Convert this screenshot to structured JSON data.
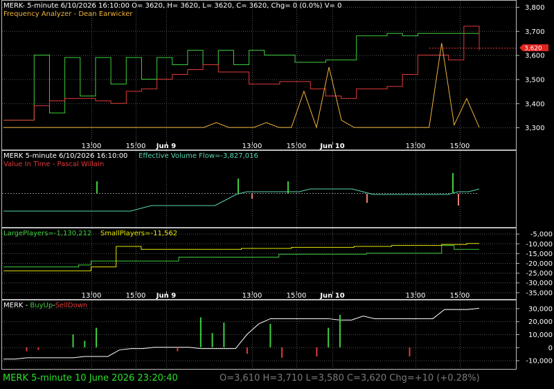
{
  "colors": {
    "green": "#3ecf3e",
    "red": "#e23a3a",
    "orange": "#f0b43a",
    "yellow": "#e8e800",
    "cyan": "#59d6b3",
    "white": "#ffffff",
    "gray": "#7a7a7a",
    "status_green": "#29e129",
    "price_badge": "#e0241e"
  },
  "panel1": {
    "header": "MERK- 5-minute 6/10/2026 16:10:00 O= 3620, H= 3620, L= 3620, C= 3620, Chg= 0 (0.0%) V= 0",
    "subtitle": "Frequency Analyzer - Dean Earwicker",
    "price_badge": "3,620",
    "y_ticks": [
      "3,800",
      "3,700",
      "3,600",
      "3,500",
      "3,400",
      "3,300"
    ],
    "time_labels": [
      "13:00",
      "15:00",
      "Jun 9",
      "13:00",
      "15:00",
      "Jun 10",
      "13:00",
      "15:00"
    ]
  },
  "panel2": {
    "header_left": "MERK 5-minute  6/10/2026 16:10:00",
    "header_right": "Effective Volume Flow=-3,827,016",
    "subtitle": "Value In Time - Pascal Willain"
  },
  "panel3": {
    "large_label": "LargePlayers=-1,130,212",
    "small_label": "SmallPlayers=-11,562",
    "y_ticks": [
      "-5,000",
      "-10,000",
      "-15,000",
      "-20,000",
      "-25,000",
      "-30,000",
      "-35,000"
    ],
    "time_labels": [
      "13:00",
      "15:00",
      "Jun 9",
      "13:00",
      "15:00",
      "Jun 10",
      "13:00",
      "15:00"
    ]
  },
  "panel4": {
    "header_ticker": "MERK - ",
    "header_buy": "BuyUp",
    "header_dash": "-",
    "header_sell": "SellDown",
    "y_ticks": [
      "30,000",
      "20,000",
      "10,000",
      "0",
      "-10,000"
    ]
  },
  "status": {
    "left": "MERK  5-minute   10 June 2026 23:20:40",
    "right": "O=3,610  H=3,710  L=3,580  C=3,620  Chg=+10 (+0.28%)"
  },
  "chart_data": [
    {
      "type": "line",
      "panel": "price",
      "ylim": [
        3260,
        3820
      ],
      "y_scale": "linear",
      "grid": true,
      "series": [
        {
          "values": [
            3330,
            3330,
            3600,
            3360,
            3590,
            3430,
            3590,
            3480,
            3590,
            3500,
            3590,
            3560,
            3620,
            3560,
            3620,
            3560,
            3620,
            3600,
            3600,
            3570,
            3570,
            3580,
            3580,
            3680,
            3680,
            3690,
            3680,
            3690,
            3690,
            3690,
            3690,
            3690
          ]
        },
        {
          "values": [
            3330,
            3330,
            3390,
            3410,
            3420,
            3420,
            3410,
            3400,
            3450,
            3460,
            3500,
            3520,
            3540,
            3560,
            3530,
            3530,
            3480,
            3480,
            3490,
            3490,
            3460,
            3430,
            3420,
            3460,
            3460,
            3470,
            3520,
            3600,
            3600,
            3580,
            3720,
            3620
          ]
        },
        {
          "values": [
            3300,
            3300,
            3300,
            3300,
            3300,
            3300,
            3300,
            3300,
            3300,
            3300,
            3300,
            3300,
            3300,
            3300,
            3300,
            3300,
            3300,
            3320,
            3300,
            3300,
            3300,
            3320,
            3300,
            3300,
            3450,
            3300,
            3550,
            3330,
            3300,
            3300,
            3300,
            3300,
            3300,
            3300,
            3300,
            3650,
            3310,
            3420,
            3300
          ]
        }
      ]
    },
    {
      "type": "line",
      "panel": "effective_volume_flow",
      "series": [
        {
          "values": [
            -5,
            -5,
            -5,
            -5,
            -5,
            -5,
            -5,
            -5,
            -5,
            -5,
            -5,
            -5,
            -5,
            -4,
            -3,
            -3,
            -3,
            -3,
            -3,
            -3,
            -3,
            -1,
            1,
            2,
            2,
            2,
            2,
            2,
            2,
            3,
            3,
            3,
            3,
            3,
            2,
            1,
            1,
            1,
            1,
            1,
            1,
            1,
            1,
            2,
            2,
            3
          ]
        }
      ]
    },
    {
      "type": "line",
      "panel": "players",
      "ylim": [
        -37000,
        -3000
      ],
      "series": [
        {
          "values": [
            -22000,
            -22000,
            -22000,
            -22000,
            -22000,
            -22000,
            -21000,
            -19000,
            -19000,
            -19000,
            -19000,
            -19000,
            -19000,
            -19000,
            -17000,
            -17000,
            -17000,
            -17000,
            -17000,
            -17000,
            -17000,
            -17000,
            -15500,
            -15500,
            -15500,
            -15500,
            -15500,
            -15500,
            -15500,
            -15000,
            -15000,
            -15000,
            -15000,
            -15000,
            -15000,
            -11000,
            -13000,
            -13000,
            -13000
          ]
        },
        {
          "values": [
            -24000,
            -24000,
            -24000,
            -24000,
            -24000,
            -24000,
            -24000,
            -22000,
            -22000,
            -11500,
            -11500,
            -13000,
            -13000,
            -13000,
            -13000,
            -13000,
            -13000,
            -13000,
            -13000,
            -12500,
            -12500,
            -12500,
            -12500,
            -12000,
            -12000,
            -12000,
            -12000,
            -12000,
            -11500,
            -11500,
            -11500,
            -11000,
            -11000,
            -11000,
            -11000,
            -10500,
            -10500,
            -10000,
            -10000
          ]
        }
      ]
    },
    {
      "type": "bar",
      "panel": "buyup_selldown",
      "ylim": [
        -15000,
        35000
      ],
      "series": [
        {
          "values": [
            -9000,
            -9000,
            -8000,
            -8000,
            -8000,
            -8000,
            -8000,
            -7000,
            -7000,
            -7000,
            -2000,
            -1000,
            -1000,
            0,
            0,
            0,
            0,
            -1000,
            -1000,
            -1000,
            -1000,
            10000,
            18000,
            22000,
            22000,
            22000,
            22000,
            22000,
            22000,
            21000,
            21000,
            24000,
            22000,
            22000,
            22000,
            22000,
            22000,
            22000,
            29000,
            29000,
            29000,
            30000
          ]
        },
        {
          "values": [
            0,
            0,
            0,
            0,
            0,
            0,
            10000,
            5000,
            15000,
            0,
            0,
            0,
            0,
            0,
            0,
            0,
            0,
            23000,
            11000,
            19000,
            0,
            0,
            0,
            18000,
            0,
            0,
            0,
            0,
            15000,
            25000,
            0,
            0,
            0,
            0,
            0,
            0,
            0,
            0,
            0,
            0,
            0,
            0
          ]
        },
        {
          "values": [
            0,
            0,
            -3000,
            -2000,
            0,
            0,
            0,
            0,
            0,
            0,
            0,
            0,
            0,
            0,
            0,
            -3000,
            0,
            0,
            0,
            0,
            0,
            -5000,
            0,
            0,
            -8000,
            0,
            0,
            -7000,
            0,
            0,
            0,
            0,
            0,
            0,
            0,
            -7000,
            0,
            0,
            0,
            0,
            0,
            0
          ]
        }
      ]
    }
  ]
}
